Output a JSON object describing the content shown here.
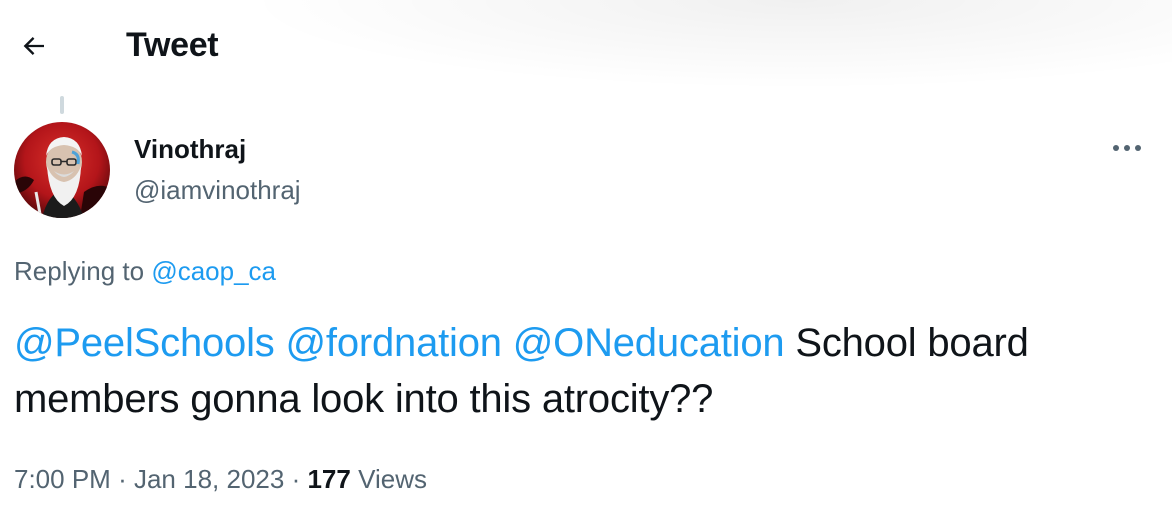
{
  "header": {
    "title": "Tweet",
    "back_icon": "arrow-left-icon"
  },
  "tweet": {
    "author": {
      "display_name": "Vinothraj",
      "handle": "@iamvinothraj",
      "avatar": "avatar-illustration"
    },
    "more_icon": "more-horizontal-icon",
    "replying": {
      "prefix": "Replying to",
      "mention": "@caop_ca"
    },
    "text": {
      "mentions": [
        "@PeelSchools",
        "@fordnation",
        "@ONeducation"
      ],
      "body": "School board members gonna look into this atrocity??"
    },
    "meta": {
      "time": "7:00 PM",
      "date": "Jan 18, 2023",
      "separator": "·",
      "views_count": "177",
      "views_label": "Views"
    }
  },
  "colors": {
    "accent": "#1d9bf0",
    "text_primary": "#0f1419",
    "text_secondary": "#536471",
    "thread_line": "#cfd9de"
  }
}
